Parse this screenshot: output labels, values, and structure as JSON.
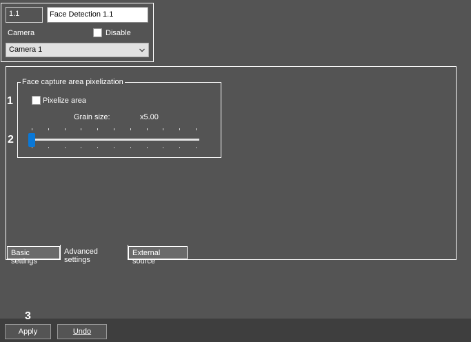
{
  "detector": {
    "id_value": "1.1",
    "name_value": "Face Detection 1.1",
    "camera_label": "Camera",
    "disable_label": "Disable",
    "disable_checked": false,
    "camera_selected": "Camera 1"
  },
  "pixelization": {
    "group_title": "Face capture area pixelization",
    "pixelize_label": "Pixelize area",
    "pixelize_checked": false,
    "grain_label": "Grain size:",
    "grain_value": "x5.00",
    "slider_level_fraction": 0.0
  },
  "tabs": [
    {
      "label": "Basic settings",
      "active": false
    },
    {
      "label": "Advanced settings",
      "active": true
    },
    {
      "label": "External source",
      "active": false
    }
  ],
  "markers": {
    "m1": "1",
    "m2": "2",
    "m3": "3"
  },
  "actions": {
    "apply_label": "Apply",
    "undo_label": "Undo"
  },
  "colors": {
    "background": "#545454",
    "slider_thumb": "#0a78d7",
    "bottom_bar": "#3e3e3e"
  },
  "icons": [
    "chevron-down-icon"
  ]
}
